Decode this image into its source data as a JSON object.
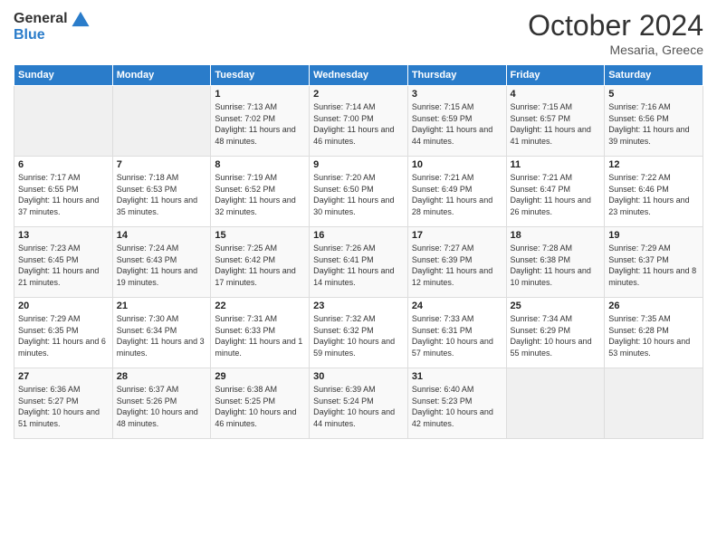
{
  "header": {
    "logo_line1": "General",
    "logo_line2": "Blue",
    "month": "October 2024",
    "location": "Mesaria, Greece"
  },
  "weekdays": [
    "Sunday",
    "Monday",
    "Tuesday",
    "Wednesday",
    "Thursday",
    "Friday",
    "Saturday"
  ],
  "weeks": [
    [
      {
        "day": "",
        "info": ""
      },
      {
        "day": "",
        "info": ""
      },
      {
        "day": "1",
        "info": "Sunrise: 7:13 AM\nSunset: 7:02 PM\nDaylight: 11 hours and 48 minutes."
      },
      {
        "day": "2",
        "info": "Sunrise: 7:14 AM\nSunset: 7:00 PM\nDaylight: 11 hours and 46 minutes."
      },
      {
        "day": "3",
        "info": "Sunrise: 7:15 AM\nSunset: 6:59 PM\nDaylight: 11 hours and 44 minutes."
      },
      {
        "day": "4",
        "info": "Sunrise: 7:15 AM\nSunset: 6:57 PM\nDaylight: 11 hours and 41 minutes."
      },
      {
        "day": "5",
        "info": "Sunrise: 7:16 AM\nSunset: 6:56 PM\nDaylight: 11 hours and 39 minutes."
      }
    ],
    [
      {
        "day": "6",
        "info": "Sunrise: 7:17 AM\nSunset: 6:55 PM\nDaylight: 11 hours and 37 minutes."
      },
      {
        "day": "7",
        "info": "Sunrise: 7:18 AM\nSunset: 6:53 PM\nDaylight: 11 hours and 35 minutes."
      },
      {
        "day": "8",
        "info": "Sunrise: 7:19 AM\nSunset: 6:52 PM\nDaylight: 11 hours and 32 minutes."
      },
      {
        "day": "9",
        "info": "Sunrise: 7:20 AM\nSunset: 6:50 PM\nDaylight: 11 hours and 30 minutes."
      },
      {
        "day": "10",
        "info": "Sunrise: 7:21 AM\nSunset: 6:49 PM\nDaylight: 11 hours and 28 minutes."
      },
      {
        "day": "11",
        "info": "Sunrise: 7:21 AM\nSunset: 6:47 PM\nDaylight: 11 hours and 26 minutes."
      },
      {
        "day": "12",
        "info": "Sunrise: 7:22 AM\nSunset: 6:46 PM\nDaylight: 11 hours and 23 minutes."
      }
    ],
    [
      {
        "day": "13",
        "info": "Sunrise: 7:23 AM\nSunset: 6:45 PM\nDaylight: 11 hours and 21 minutes."
      },
      {
        "day": "14",
        "info": "Sunrise: 7:24 AM\nSunset: 6:43 PM\nDaylight: 11 hours and 19 minutes."
      },
      {
        "day": "15",
        "info": "Sunrise: 7:25 AM\nSunset: 6:42 PM\nDaylight: 11 hours and 17 minutes."
      },
      {
        "day": "16",
        "info": "Sunrise: 7:26 AM\nSunset: 6:41 PM\nDaylight: 11 hours and 14 minutes."
      },
      {
        "day": "17",
        "info": "Sunrise: 7:27 AM\nSunset: 6:39 PM\nDaylight: 11 hours and 12 minutes."
      },
      {
        "day": "18",
        "info": "Sunrise: 7:28 AM\nSunset: 6:38 PM\nDaylight: 11 hours and 10 minutes."
      },
      {
        "day": "19",
        "info": "Sunrise: 7:29 AM\nSunset: 6:37 PM\nDaylight: 11 hours and 8 minutes."
      }
    ],
    [
      {
        "day": "20",
        "info": "Sunrise: 7:29 AM\nSunset: 6:35 PM\nDaylight: 11 hours and 6 minutes."
      },
      {
        "day": "21",
        "info": "Sunrise: 7:30 AM\nSunset: 6:34 PM\nDaylight: 11 hours and 3 minutes."
      },
      {
        "day": "22",
        "info": "Sunrise: 7:31 AM\nSunset: 6:33 PM\nDaylight: 11 hours and 1 minute."
      },
      {
        "day": "23",
        "info": "Sunrise: 7:32 AM\nSunset: 6:32 PM\nDaylight: 10 hours and 59 minutes."
      },
      {
        "day": "24",
        "info": "Sunrise: 7:33 AM\nSunset: 6:31 PM\nDaylight: 10 hours and 57 minutes."
      },
      {
        "day": "25",
        "info": "Sunrise: 7:34 AM\nSunset: 6:29 PM\nDaylight: 10 hours and 55 minutes."
      },
      {
        "day": "26",
        "info": "Sunrise: 7:35 AM\nSunset: 6:28 PM\nDaylight: 10 hours and 53 minutes."
      }
    ],
    [
      {
        "day": "27",
        "info": "Sunrise: 6:36 AM\nSunset: 5:27 PM\nDaylight: 10 hours and 51 minutes."
      },
      {
        "day": "28",
        "info": "Sunrise: 6:37 AM\nSunset: 5:26 PM\nDaylight: 10 hours and 48 minutes."
      },
      {
        "day": "29",
        "info": "Sunrise: 6:38 AM\nSunset: 5:25 PM\nDaylight: 10 hours and 46 minutes."
      },
      {
        "day": "30",
        "info": "Sunrise: 6:39 AM\nSunset: 5:24 PM\nDaylight: 10 hours and 44 minutes."
      },
      {
        "day": "31",
        "info": "Sunrise: 6:40 AM\nSunset: 5:23 PM\nDaylight: 10 hours and 42 minutes."
      },
      {
        "day": "",
        "info": ""
      },
      {
        "day": "",
        "info": ""
      }
    ]
  ]
}
